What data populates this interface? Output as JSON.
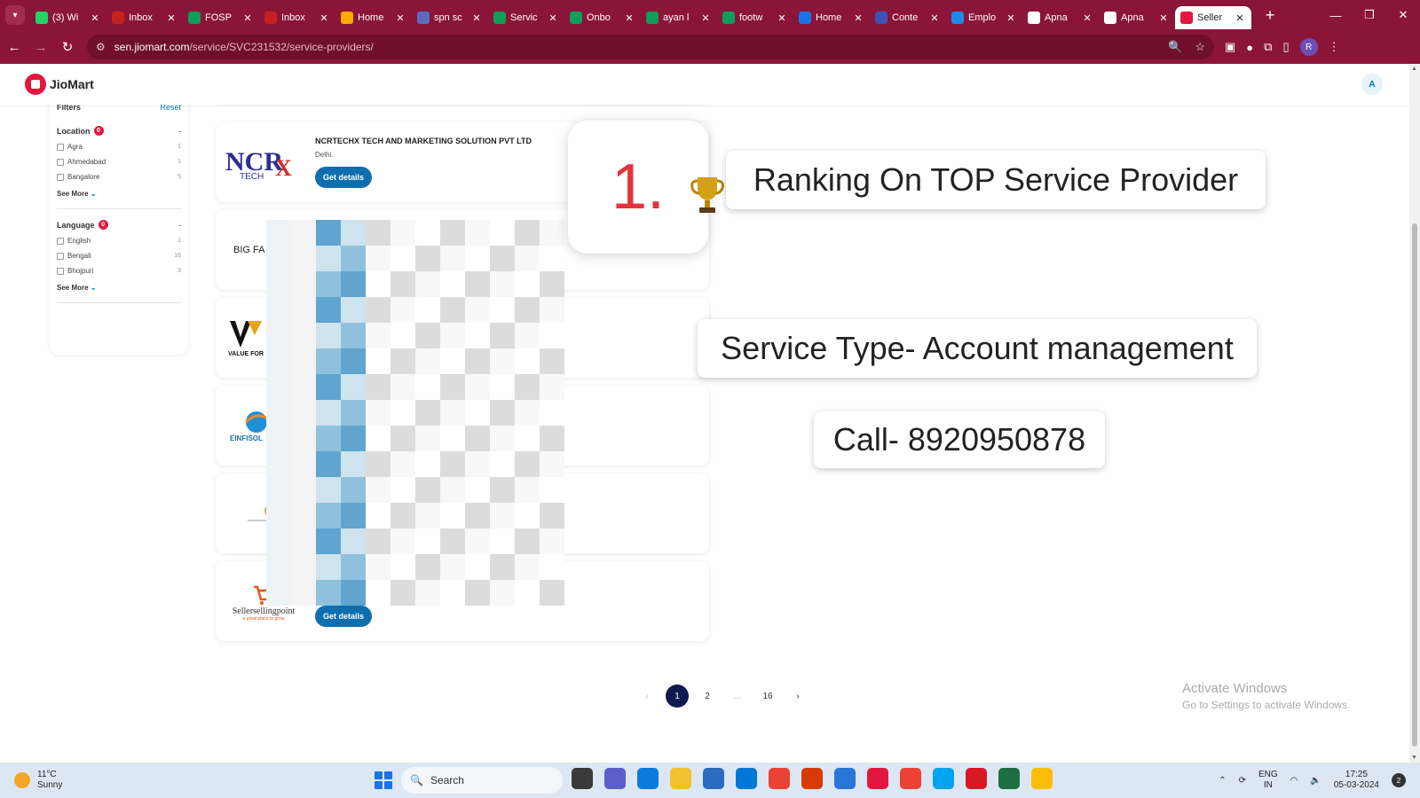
{
  "browser": {
    "tabs": [
      {
        "label": "(3) Wi",
        "color": "#25d366"
      },
      {
        "label": "Inbox",
        "color": "#c5221f"
      },
      {
        "label": "FOSP",
        "color": "#0f9d58"
      },
      {
        "label": "Inbox",
        "color": "#c5221f"
      },
      {
        "label": "Home",
        "color": "#f9ab00"
      },
      {
        "label": "spn sc",
        "color": "#5c6bc0"
      },
      {
        "label": "Servic",
        "color": "#0f9d58"
      },
      {
        "label": "Onbo",
        "color": "#0f9d58"
      },
      {
        "label": "ayan l",
        "color": "#0f9d58"
      },
      {
        "label": "footw",
        "color": "#0f9d58"
      },
      {
        "label": "Home",
        "color": "#1a73e8"
      },
      {
        "label": "Conte",
        "color": "#3f51b5"
      },
      {
        "label": "Emplo",
        "color": "#1e88e5"
      },
      {
        "label": "Apna",
        "color": "#ffffff"
      },
      {
        "label": "Apna",
        "color": "#ffffff"
      },
      {
        "label": "Seller",
        "color": "#e3173e"
      }
    ],
    "active_tab_index": 15,
    "url_host": "sen.jiomart.com",
    "url_path": "/service/SVC231532/service-providers/",
    "profile_initial": "R",
    "accent": "#8a1538"
  },
  "site": {
    "logo_text": "JioMart",
    "avatar": "A"
  },
  "filters": {
    "title": "Filters",
    "reset": "Reset",
    "location": {
      "title": "Location",
      "count": "0",
      "options": [
        {
          "label": "Agra",
          "count": "1"
        },
        {
          "label": "Ahmedabad",
          "count": "1"
        },
        {
          "label": "Bangalore",
          "count": "5"
        }
      ],
      "see_more": "See More"
    },
    "language": {
      "title": "Language",
      "count": "0",
      "options": [
        {
          "label": "English",
          "count": "1"
        },
        {
          "label": "Bengali",
          "count": "16"
        },
        {
          "label": "Bhojpuri",
          "count": "3"
        }
      ],
      "see_more": "See More"
    }
  },
  "providers": [
    {
      "name": "NCRTECHX TECH AND MARKETING SOLUTION PVT LTD",
      "location": "Delhi.",
      "button": "Get details",
      "logo_text": "NCRTECHX"
    },
    {
      "name": "",
      "location": "",
      "button": "",
      "logo_text": "BIG FA"
    },
    {
      "name": "",
      "location": "",
      "button": "",
      "logo_text": "VALUE FOR"
    },
    {
      "name": "",
      "location": "",
      "button": "",
      "logo_text": "EINFISOL"
    },
    {
      "name": "",
      "location": "",
      "button": "",
      "logo_text": ""
    },
    {
      "name": "",
      "location": "",
      "button": "Get details",
      "logo_text": "Sellersellingpoint",
      "logo_subtext": "a great place to grow"
    }
  ],
  "overlays": {
    "rank": "1.",
    "ranking_text": "Ranking On TOP Service Provider",
    "service_text": "Service Type- Account management",
    "call_text": "Call- 8920950878"
  },
  "pagination": {
    "prev": "‹",
    "pages": [
      "1",
      "2",
      "...",
      "16"
    ],
    "current": "1",
    "next": "›"
  },
  "watermark": {
    "line1": "Activate Windows",
    "line2": "Go to Settings to activate Windows."
  },
  "taskbar": {
    "temperature": "11°C",
    "weather": "Sunny",
    "search_label": "Search",
    "lang_line1": "ENG",
    "lang_line2": "IN",
    "time": "17:25",
    "date": "05-03-2024",
    "notifications": "2",
    "app_colors": [
      "#3a3a3a",
      "#5b5fc7",
      "#0c7bdc",
      "#f2c12e",
      "#2a6cc0",
      "#0078d4",
      "#ea4335",
      "#d83b01",
      "#2876d7",
      "#e3173e",
      "#ea4335",
      "#00a4ef",
      "#d71921",
      "#1d6f42",
      "#fbbc05"
    ]
  }
}
